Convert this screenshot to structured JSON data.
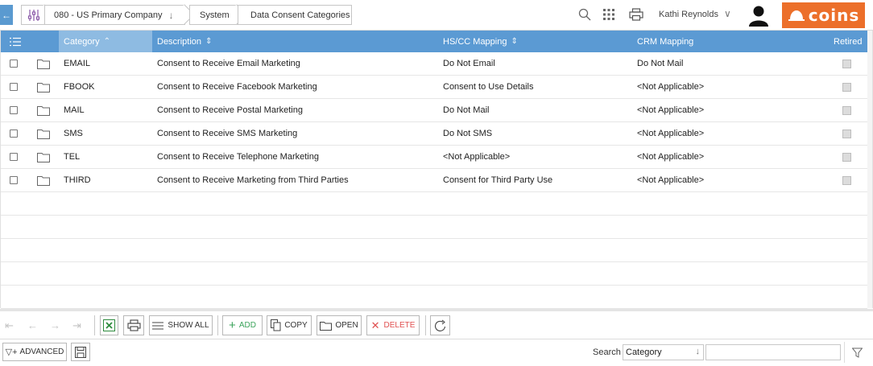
{
  "breadcrumb": {
    "company": "080 - US Primary Company",
    "section": "System",
    "page": "Data Consent Categories"
  },
  "user": {
    "name": "Kathi Reynolds"
  },
  "brand": {
    "logo_text": "coins",
    "color": "#ec6f2a"
  },
  "grid": {
    "accent": "#5b9ad3",
    "columns": {
      "category": "Category",
      "description": "Description",
      "hscc": "HS/CC Mapping",
      "crm": "CRM Mapping",
      "retired": "Retired"
    },
    "rows": [
      {
        "category": "EMAIL",
        "description": "Consent to Receive Email Marketing",
        "hscc": "Do Not Email",
        "crm": "Do Not Mail"
      },
      {
        "category": "FBOOK",
        "description": "Consent to Receive Facebook Marketing",
        "hscc": "Consent to Use Details",
        "crm": "<Not Applicable>"
      },
      {
        "category": "MAIL",
        "description": "Consent to Receive Postal Marketing",
        "hscc": "Do Not Mail",
        "crm": "<Not Applicable>"
      },
      {
        "category": "SMS",
        "description": "Consent to Receive SMS Marketing",
        "hscc": "Do Not SMS",
        "crm": "<Not Applicable>"
      },
      {
        "category": "TEL",
        "description": "Consent to Receive Telephone Marketing",
        "hscc": "<Not Applicable>",
        "crm": "<Not Applicable>"
      },
      {
        "category": "THIRD",
        "description": "Consent to Receive Marketing from Third Parties",
        "hscc": "Consent for Third Party Use",
        "crm": "<Not Applicable>"
      }
    ]
  },
  "toolbar": {
    "show_all": "SHOW ALL",
    "add": "ADD",
    "copy": "COPY",
    "open": "OPEN",
    "delete": "DELETE"
  },
  "footer": {
    "advanced": "ADVANCED",
    "search_label": "Search",
    "search_field": "Category",
    "search_value": ""
  }
}
